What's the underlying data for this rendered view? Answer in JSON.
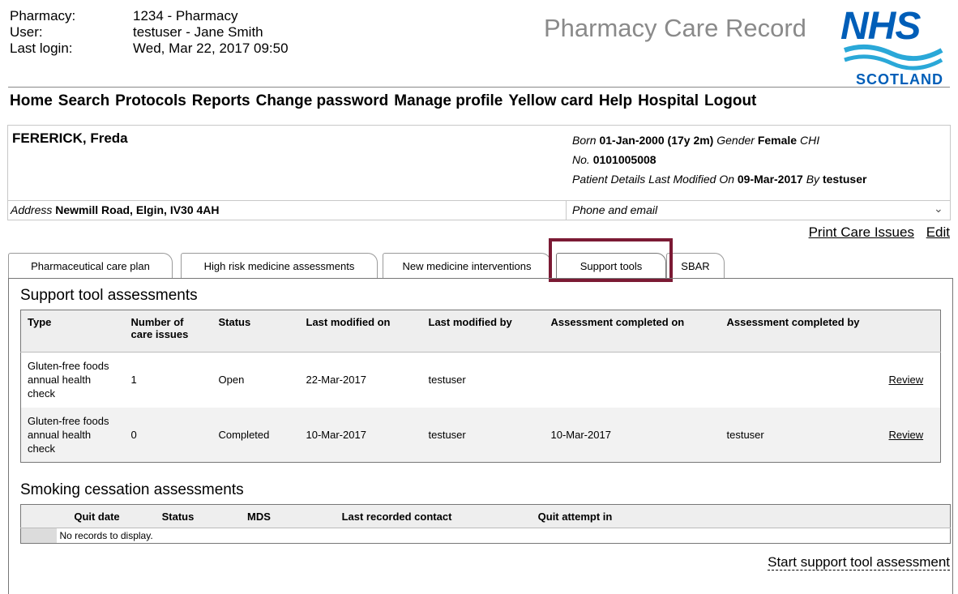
{
  "header": {
    "pharmacy_label": "Pharmacy:",
    "pharmacy_value": "1234 - Pharmacy",
    "user_label": "User:",
    "user_value": "testuser - Jane Smith",
    "last_login_label": "Last login:",
    "last_login_value": "Wed, Mar 22, 2017 09:50",
    "app_title": "Pharmacy Care Record",
    "logo_text": "NHS",
    "logo_sub": "SCOTLAND"
  },
  "nav": [
    "Home",
    "Search",
    "Protocols",
    "Reports",
    "Change password",
    "Manage profile",
    "Yellow card",
    "Help",
    "Hospital",
    "Logout"
  ],
  "patient": {
    "name": "FERERICK, Freda",
    "born_label": "Born",
    "born": "01-Jan-2000",
    "age": "(17y 2m)",
    "gender_label": "Gender",
    "gender": "Female",
    "chi_label": "CHI",
    "no_label": "No.",
    "chi": "0101005008",
    "modified_label": "Patient Details Last Modified On",
    "modified_on": "09-Mar-2017",
    "by_label": "By",
    "modified_by": "testuser",
    "address_label": "Address",
    "address": "Newmill Road, Elgin, IV30 4AH",
    "phone_label": "Phone and email"
  },
  "links": {
    "print": "Print Care Issues",
    "edit": "Edit"
  },
  "tabs": [
    "Pharmaceutical care plan",
    "High risk medicine assessments",
    "New medicine interventions",
    "Support tools",
    "SBAR"
  ],
  "active_tab": "Support tools",
  "support": {
    "title": "Support tool assessments",
    "columns": [
      "Type",
      "Number of care issues",
      "Status",
      "Last modified on",
      "Last modified by",
      "Assessment completed on",
      "Assessment completed by"
    ],
    "rows": [
      {
        "type": "Gluten-free foods annual health check",
        "issues": "1",
        "status": "Open",
        "modified_on": "22-Mar-2017",
        "modified_by": "testuser",
        "completed_on": "",
        "completed_by": "",
        "action": "Review"
      },
      {
        "type": "Gluten-free foods annual health check",
        "issues": "0",
        "status": "Completed",
        "modified_on": "10-Mar-2017",
        "modified_by": "testuser",
        "completed_on": "10-Mar-2017",
        "completed_by": "testuser",
        "action": "Review"
      }
    ]
  },
  "smoking": {
    "title": "Smoking cessation assessments",
    "columns": [
      "Quit date",
      "Status",
      "MDS",
      "Last recorded contact",
      "Quit attempt in"
    ],
    "empty": "No records to display."
  },
  "start_link": "Start support tool assessment",
  "colors": {
    "highlight": "#7b1a34",
    "nhs_blue": "#005eb8"
  }
}
